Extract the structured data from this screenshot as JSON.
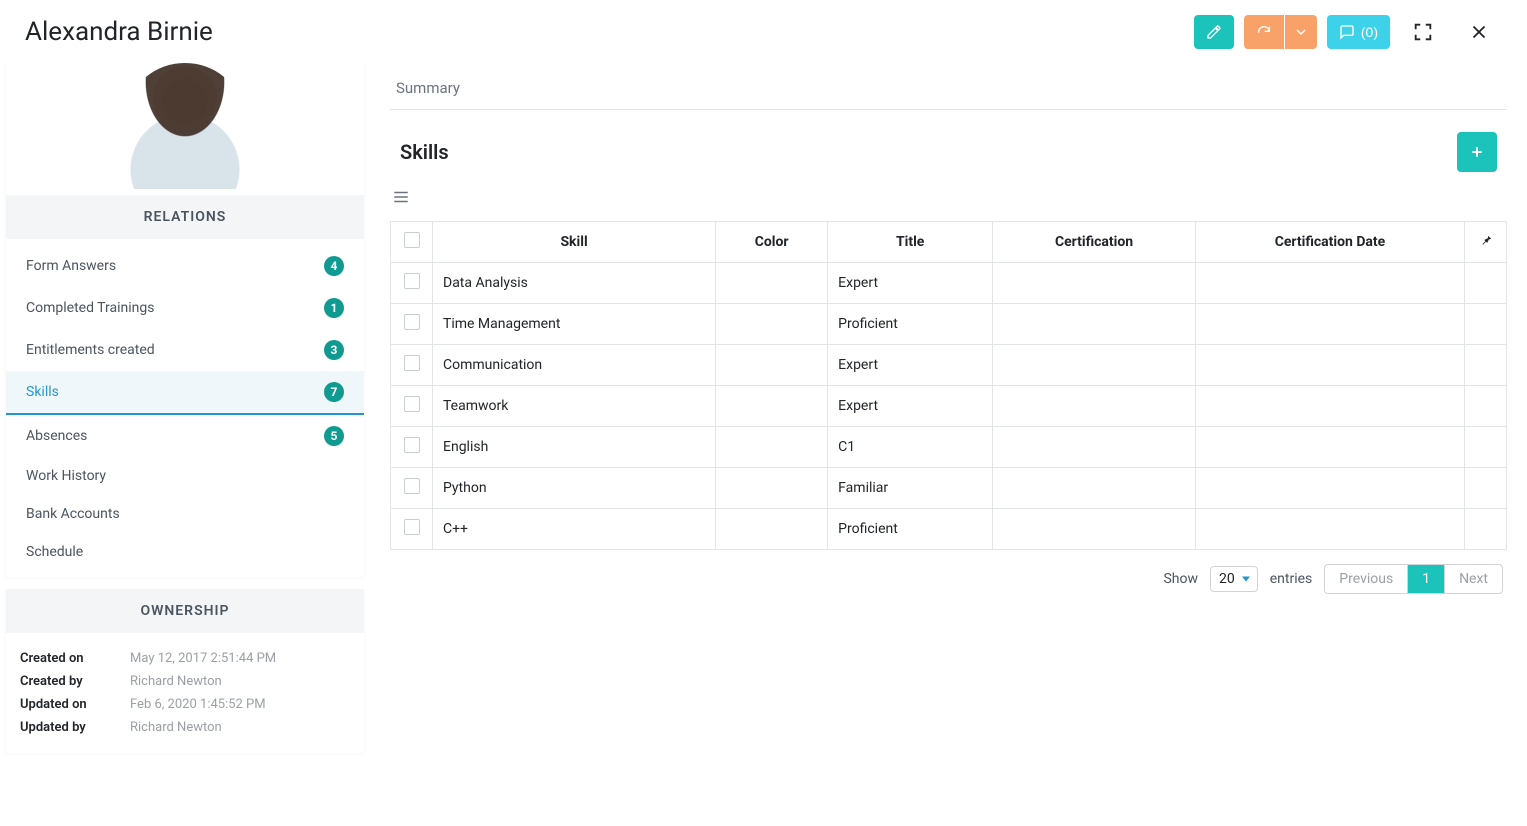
{
  "header": {
    "title": "Alexandra Birnie",
    "comments_label": "(0)"
  },
  "relations": {
    "heading": "RELATIONS",
    "items": [
      {
        "label": "Form Answers",
        "count": "4",
        "active": false
      },
      {
        "label": "Completed Trainings",
        "count": "1",
        "active": false
      },
      {
        "label": "Entitlements created",
        "count": "3",
        "active": false
      },
      {
        "label": "Skills",
        "count": "7",
        "active": true
      },
      {
        "label": "Absences",
        "count": "5",
        "active": false
      },
      {
        "label": "Work History",
        "count": "",
        "active": false
      },
      {
        "label": "Bank Accounts",
        "count": "",
        "active": false
      },
      {
        "label": "Schedule",
        "count": "",
        "active": false
      }
    ]
  },
  "ownership": {
    "heading": "OWNERSHIP",
    "rows": [
      {
        "label": "Created on",
        "value": "May 12, 2017 2:51:44 PM"
      },
      {
        "label": "Created by",
        "value": "Richard Newton"
      },
      {
        "label": "Updated on",
        "value": "Feb 6, 2020 1:45:52 PM"
      },
      {
        "label": "Updated by",
        "value": "Richard Newton"
      }
    ]
  },
  "main": {
    "tab_summary": "Summary",
    "section_title": "Skills",
    "columns": [
      "Skill",
      "Color",
      "Title",
      "Certification",
      "Certification Date"
    ],
    "rows": [
      {
        "skill": "Data Analysis",
        "color": "",
        "title": "Expert",
        "cert": "",
        "cert_date": ""
      },
      {
        "skill": "Time Management",
        "color": "",
        "title": "Proficient",
        "cert": "",
        "cert_date": ""
      },
      {
        "skill": "Communication",
        "color": "",
        "title": "Expert",
        "cert": "",
        "cert_date": ""
      },
      {
        "skill": "Teamwork",
        "color": "",
        "title": "Expert",
        "cert": "",
        "cert_date": ""
      },
      {
        "skill": "English",
        "color": "",
        "title": "C1",
        "cert": "",
        "cert_date": ""
      },
      {
        "skill": "Python",
        "color": "",
        "title": "Familiar",
        "cert": "",
        "cert_date": ""
      },
      {
        "skill": "C++",
        "color": "",
        "title": "Proficient",
        "cert": "",
        "cert_date": ""
      }
    ],
    "pager": {
      "show_label": "Show",
      "page_size": "20",
      "entries_label": "entries",
      "previous": "Previous",
      "current": "1",
      "next": "Next"
    }
  }
}
